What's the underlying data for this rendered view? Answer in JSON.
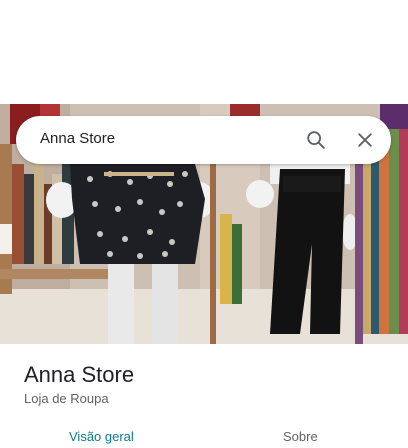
{
  "search": {
    "query": "Anna Store",
    "search_icon": "search-icon",
    "close_icon": "close-icon"
  },
  "place": {
    "name": "Anna Store",
    "category": "Loja de Roupa"
  },
  "tabs": [
    {
      "label": "Visão geral",
      "active": true
    },
    {
      "label": "Sobre",
      "active": false
    }
  ],
  "colors": {
    "active_tab": "#0b7a8a",
    "text_primary": "#202124",
    "text_secondary": "#5f6368"
  }
}
